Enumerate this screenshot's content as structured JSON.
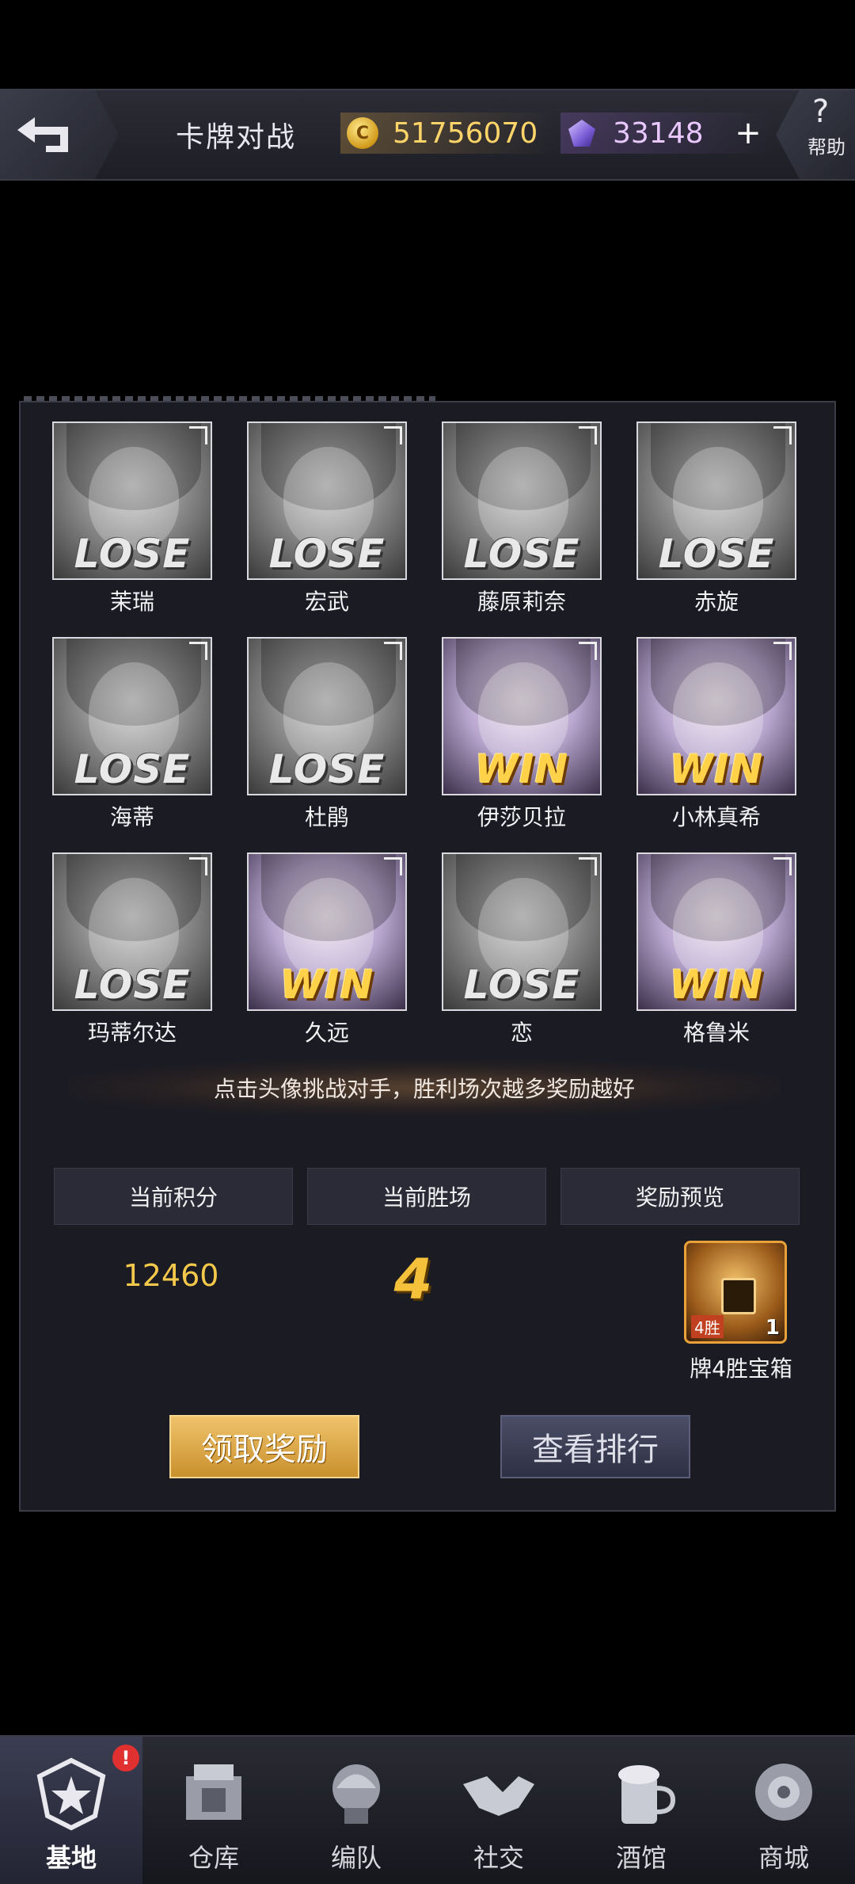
{
  "header": {
    "title": "卡牌对战",
    "gold": "51756070",
    "gems": "33148",
    "plus": "+",
    "help_icon": "?",
    "help_label": "帮助"
  },
  "opponents": [
    {
      "name": "茉瑞",
      "result": "LOSE"
    },
    {
      "name": "宏武",
      "result": "LOSE"
    },
    {
      "name": "藤原莉奈",
      "result": "LOSE"
    },
    {
      "name": "赤旋",
      "result": "LOSE"
    },
    {
      "name": "海蒂",
      "result": "LOSE"
    },
    {
      "name": "杜鹃",
      "result": "LOSE"
    },
    {
      "name": "伊莎贝拉",
      "result": "WIN"
    },
    {
      "name": "小林真希",
      "result": "WIN"
    },
    {
      "name": "玛蒂尔达",
      "result": "LOSE"
    },
    {
      "name": "久远",
      "result": "WIN"
    },
    {
      "name": "恋",
      "result": "LOSE"
    },
    {
      "name": "格鲁米",
      "result": "WIN"
    }
  ],
  "hint": "点击头像挑战对手，胜利场次越多奖励越好",
  "info": {
    "score_header": "当前积分",
    "wins_header": "当前胜场",
    "reward_header": "奖励预览",
    "score": "12460",
    "wins": "4",
    "chest_tag": "4胜",
    "chest_count": "1",
    "chest_name": "牌4胜宝箱"
  },
  "buttons": {
    "claim": "领取奖励",
    "rank": "查看排行"
  },
  "nav": {
    "badge": "!",
    "items": [
      {
        "label": "基地",
        "icon": "base-icon"
      },
      {
        "label": "仓库",
        "icon": "warehouse-icon"
      },
      {
        "label": "编队",
        "icon": "formation-icon"
      },
      {
        "label": "社交",
        "icon": "handshake-icon"
      },
      {
        "label": "酒馆",
        "icon": "tavern-icon"
      },
      {
        "label": "商城",
        "icon": "shop-icon"
      }
    ]
  },
  "colors": {
    "accent_gold": "#f5c13a",
    "win": "#ffd24a",
    "lose": "#e9e9e9",
    "panel_bg": "#1a1b23"
  }
}
